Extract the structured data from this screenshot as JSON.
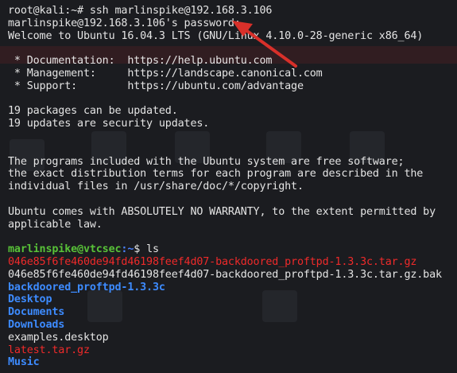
{
  "terminal": {
    "lines": {
      "l1": "root@kali:~# ssh marlinspike@192.168.3.106",
      "l2": "marlinspike@192.168.3.106's password: ",
      "l3": "Welcome to Ubuntu 16.04.3 LTS (GNU/Linux 4.10.0-28-generic x86_64)",
      "l5": " * Documentation:  https://help.ubuntu.com",
      "l6": " * Management:     https://landscape.canonical.com",
      "l7": " * Support:        https://ubuntu.com/advantage",
      "l9": "19 packages can be updated.",
      "l10": "19 updates are security updates.",
      "l13": "The programs included with the Ubuntu system are free software;",
      "l14": "the exact distribution terms for each program are described in the",
      "l15": "individual files in /usr/share/doc/*/copyright.",
      "l17": "Ubuntu comes with ABSOLUTELY NO WARRANTY, to the extent permitted by",
      "l18": "applicable law."
    },
    "prompt": {
      "user_host": "marlinspike@vtcsec",
      "path": ":~",
      "symbol": "$ ",
      "command": "ls"
    },
    "ls_output": [
      {
        "name": "046e85f6fe460de94fd46198feef4d07-backdoored_proftpd-1.3.3c.tar.gz",
        "kind": "archive"
      },
      {
        "name": "046e85f6fe460de94fd46198feef4d07-backdoored_proftpd-1.3.3c.tar.gz.bak",
        "kind": "file"
      },
      {
        "name": "backdoored_proftpd-1.3.3c",
        "kind": "directory"
      },
      {
        "name": "Desktop",
        "kind": "directory"
      },
      {
        "name": "Documents",
        "kind": "directory"
      },
      {
        "name": "Downloads",
        "kind": "directory"
      },
      {
        "name": "examples.desktop",
        "kind": "file"
      },
      {
        "name": "latest.tar.gz",
        "kind": "archive"
      },
      {
        "name": "Music",
        "kind": "directory"
      }
    ]
  },
  "colors": {
    "background": "#1b1c20",
    "text": "#e4e4e4",
    "prompt_user": "#58c238",
    "prompt_path": "#4a82ff",
    "archive": "#ef2a2a",
    "directory": "#3d8bff",
    "annotation_arrow": "#d8302a"
  },
  "annotation": {
    "icon": "red-arrow-pointing-to-password-prompt"
  }
}
